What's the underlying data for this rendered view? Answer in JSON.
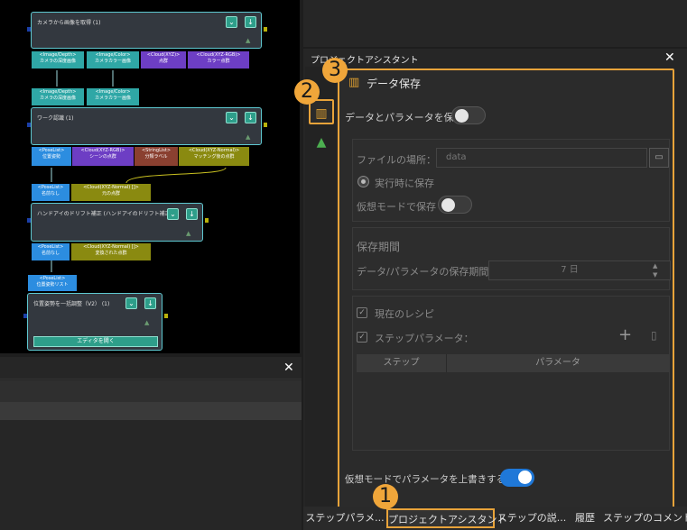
{
  "graph": {
    "nodes": [
      {
        "title": "カメラから画像を取得 (1)"
      },
      {
        "title": "ワーク認識 (1)"
      },
      {
        "title": "ハンドアイのドリフト補正 (ハンドアイのドリフト補正)"
      },
      {
        "title": "位置姿勢を一括調整（V2） (1)",
        "button": "エディタを開く"
      }
    ],
    "ports": {
      "p1": "<Image/Depth>\nカメラの深度画像",
      "p2": "<Image/Color>\nカメラカラー画像",
      "p3": "<Cloud(XYZ)>\n点群",
      "p4": "<Cloud(XYZ-RGB)>\nカラー点群",
      "p5": "<Image/Depth>\nカメラの深度画像",
      "p6": "<Image/Color>\nカメラカラー画像",
      "p7": "<PoseList>\n位置姿勢",
      "p8": "<Cloud(XYZ-RGB)>\nシーンの点群",
      "p9": "<StringList>\n分類ラベル",
      "p10": "<Cloud(XYZ-Normal)>\nマッチング後の点群",
      "p11": "<PoseList>\n名前なし",
      "p12": "<Cloud(XYZ-Normal) []>\n元の点群",
      "p13": "<PoseList>\n名前なし",
      "p14": "<Cloud(XYZ-Normal) []>\n変換された点群",
      "p15": "<PoseList>\n位置姿勢リスト"
    }
  },
  "panel": {
    "title": "プロジェクトアシスタント",
    "section_title": "データ保存",
    "save_toggle_label": "データとパラメータを保存",
    "file_location_label": "ファイルの場所：",
    "file_location_placeholder": "data",
    "save_on_run_label": "実行時に保存",
    "virtual_mode_save_label": "仮想モードで保存",
    "retention_heading": "保存期間",
    "retention_label": "データ/パラメータの保存期間:",
    "retention_value": "7 日",
    "current_recipe_label": "現在のレシピ",
    "step_params_label": "ステップパラメータ：",
    "table_headers": [
      "ステップ",
      "パラメータ"
    ],
    "override_label": "仮想モードでパラメータを上書きする"
  },
  "bottom_tabs": [
    "ステップパラメ...",
    "プロジェクトアシスタント",
    "ステップの説...",
    "履歴",
    "ステップのコメント"
  ],
  "badges": [
    "1",
    "2",
    "3"
  ],
  "colors": {
    "accent": "#f0a63a",
    "toggle_on": "#1f78d8",
    "node_border": "#5ec8d0"
  }
}
